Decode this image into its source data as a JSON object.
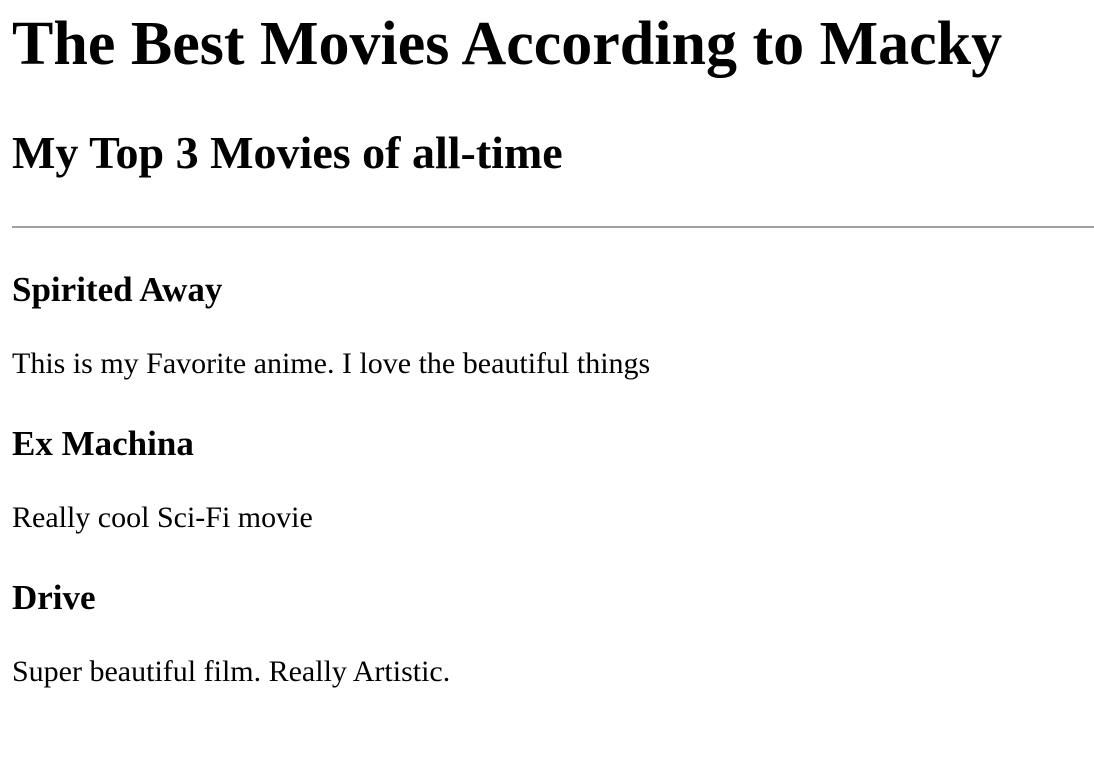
{
  "header": {
    "title": "The Best Movies According to Macky",
    "subtitle": "My Top 3 Movies of all-time"
  },
  "movies": [
    {
      "title": "Spirited Away",
      "description": "This is my Favorite anime. I love the beautiful things"
    },
    {
      "title": "Ex Machina",
      "description": "Really cool Sci-Fi movie"
    },
    {
      "title": "Drive",
      "description": "Super beautiful film. Really Artistic."
    }
  ]
}
